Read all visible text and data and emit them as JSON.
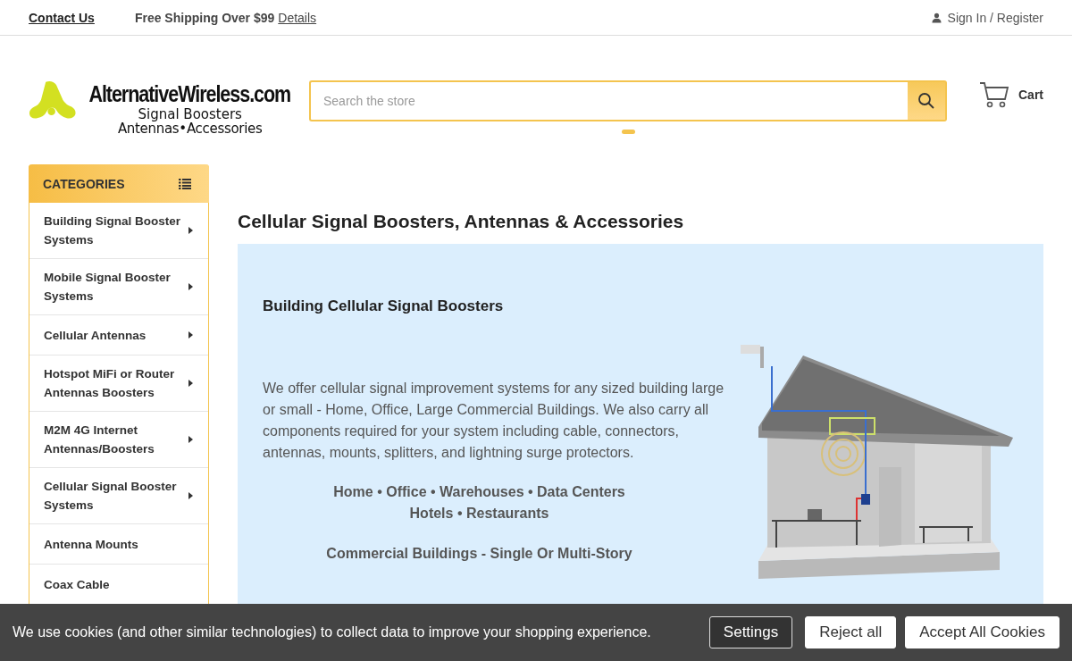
{
  "top_bar": {
    "contact_link": "Contact Us",
    "shipping_text": "Free Shipping Over $99",
    "details_link": "Details",
    "account_link": "Sign In / Register"
  },
  "logo": {
    "name": "AlternativeWireless.com",
    "tagline_1": "Signal Boosters",
    "tagline_2": "Antennas•Accessories"
  },
  "search": {
    "placeholder": "Search the store"
  },
  "cart": {
    "label": "Cart"
  },
  "categories": {
    "title": "CATEGORIES",
    "items": [
      {
        "label": "Building Signal Booster Systems",
        "has_submenu": true
      },
      {
        "label": "Mobile Signal Booster Systems",
        "has_submenu": true
      },
      {
        "label": "Cellular Antennas",
        "has_submenu": true
      },
      {
        "label": "Hotspot MiFi or Router Antennas Boosters",
        "has_submenu": true
      },
      {
        "label": "M2M 4G Internet Antennas/Boosters",
        "has_submenu": true
      },
      {
        "label": "Cellular Signal Booster Systems",
        "has_submenu": true
      },
      {
        "label": "Antenna Mounts",
        "has_submenu": false
      },
      {
        "label": "Coax Cable",
        "has_submenu": false
      }
    ]
  },
  "page_title": "Cellular Signal Boosters, Antennas & Accessories",
  "banner": {
    "heading": "Building Cellular Signal Boosters",
    "body": "We offer cellular signal improvement systems for any sized building large or small - Home, Office, Large Commercial Buildings. We also carry all components required for your system including cable, connectors, antennas, mounts, splitters, and lightning surge protectors.",
    "places_1": "Home • Office • Warehouses • Data Centers",
    "places_2": "Hotels • Restaurants",
    "building_types": "Commercial Buildings - Single Or Multi-Story"
  },
  "cookie_bar": {
    "message": "We use cookies (and other similar technologies) to collect data to improve your shopping experience.",
    "buttons": [
      "Settings",
      "Reject all",
      "Accept All Cookies"
    ]
  }
}
